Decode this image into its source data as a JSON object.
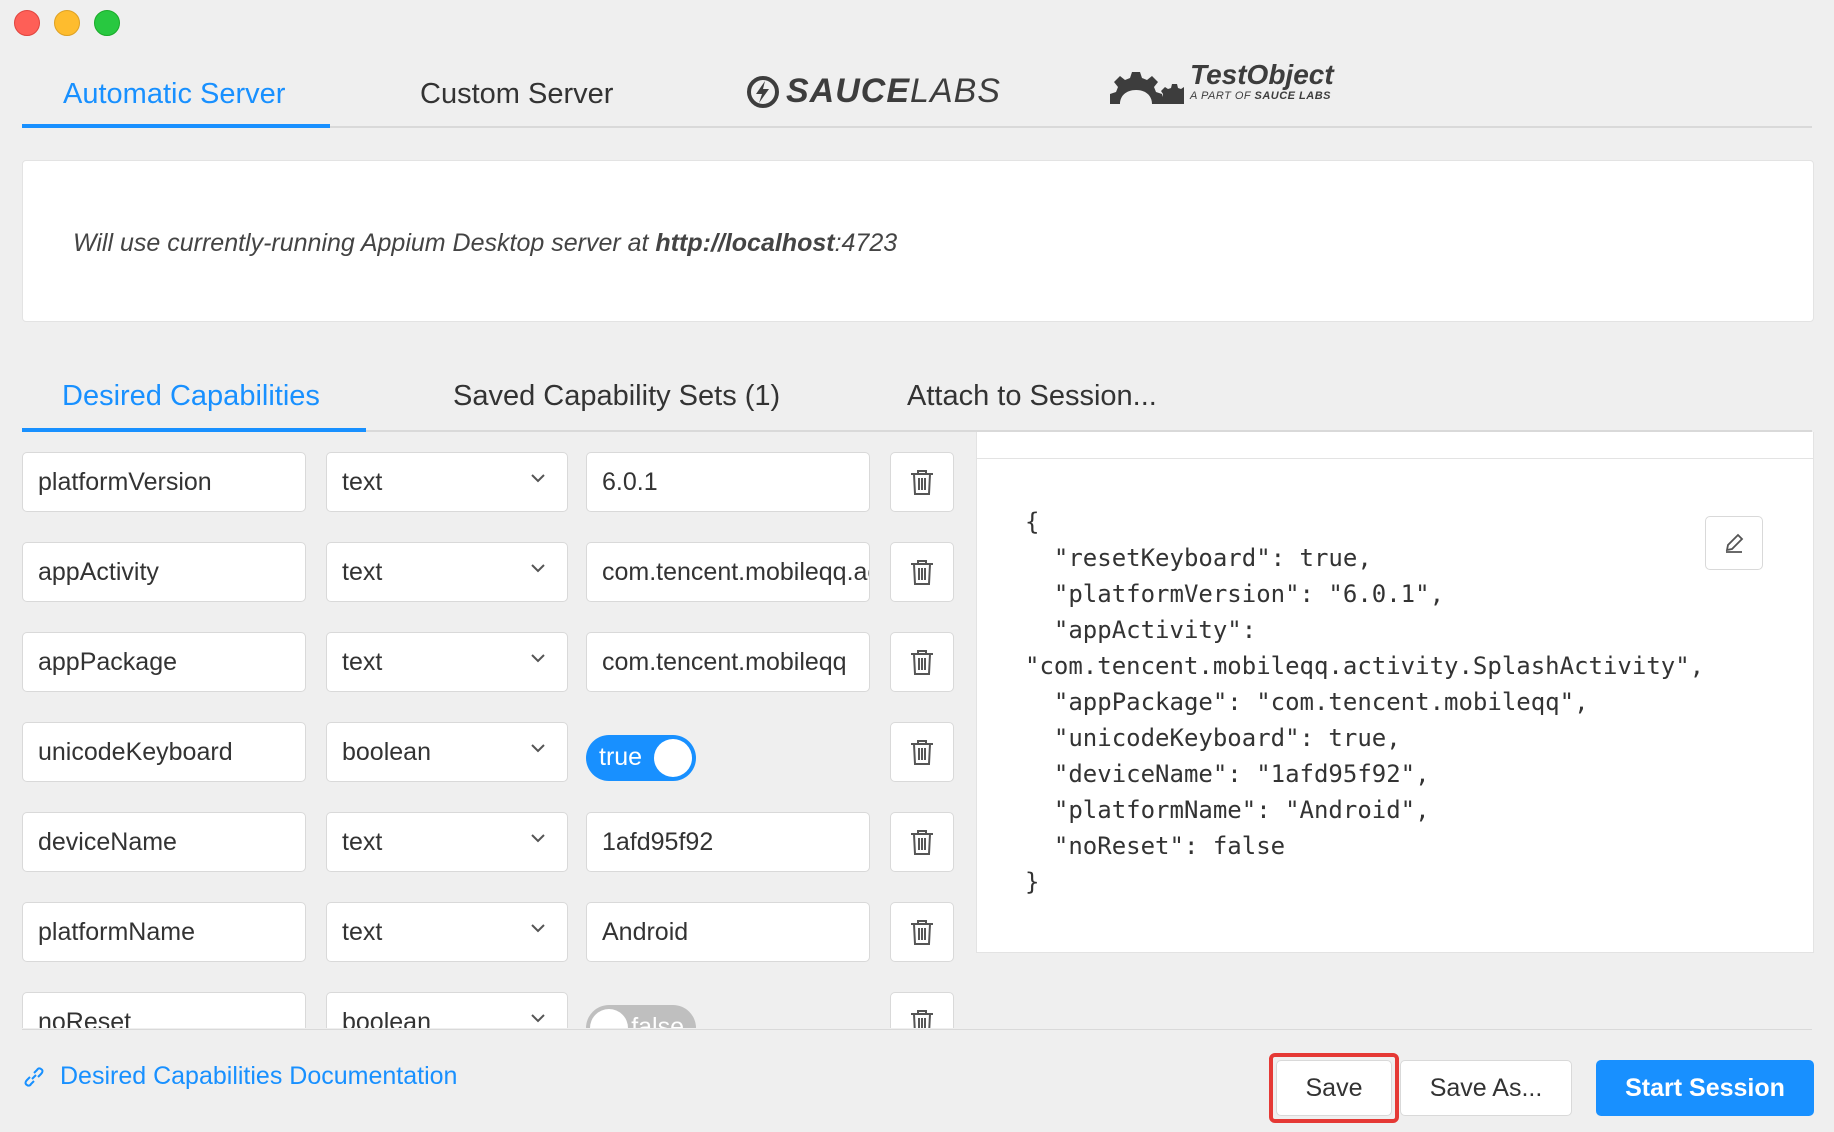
{
  "window": {
    "controls": [
      "close",
      "minimize",
      "zoom"
    ]
  },
  "server_tabs": {
    "automatic": "Automatic Server",
    "custom": "Custom Server",
    "saucelabs_bold": "SAUCE",
    "saucelabs_light": "LABS",
    "testobject_title": "TestObject",
    "testobject_sub_prefix": "A PART OF ",
    "testobject_sub_brand": "SAUCE LABS"
  },
  "server_info": {
    "message": "Will use currently-running Appium Desktop server at ",
    "url_bold": "http://localhost",
    "url_port": ":4723"
  },
  "cap_tabs": {
    "desired": "Desired Capabilities",
    "saved": "Saved Capability Sets (1)",
    "attach": "Attach to Session..."
  },
  "capabilities": [
    {
      "name": "platformVersion",
      "type": "text",
      "value": "6.0.1"
    },
    {
      "name": "appActivity",
      "type": "text",
      "value": "com.tencent.mobileqq.activity.SplashActivity"
    },
    {
      "name": "appPackage",
      "type": "text",
      "value": "com.tencent.mobileqq"
    },
    {
      "name": "unicodeKeyboard",
      "type": "boolean",
      "value": "true"
    },
    {
      "name": "deviceName",
      "type": "text",
      "value": "1afd95f92"
    },
    {
      "name": "platformName",
      "type": "text",
      "value": "Android"
    },
    {
      "name": "noReset",
      "type": "boolean",
      "value": "false"
    }
  ],
  "json_preview": "{\n  \"resetKeyboard\": true,\n  \"platformVersion\": \"6.0.1\",\n  \"appActivity\":\n\"com.tencent.mobileqq.activity.SplashActivity\",\n  \"appPackage\": \"com.tencent.mobileqq\",\n  \"unicodeKeyboard\": true,\n  \"deviceName\": \"1afd95f92\",\n  \"platformName\": \"Android\",\n  \"noReset\": false\n}",
  "footer": {
    "doc_link": "Desired Capabilities Documentation",
    "save": "Save",
    "save_as": "Save As...",
    "start": "Start Session"
  },
  "colors": {
    "accent": "#1890ff",
    "highlight": "#e53935",
    "toggle_off": "#bfbfbf"
  }
}
